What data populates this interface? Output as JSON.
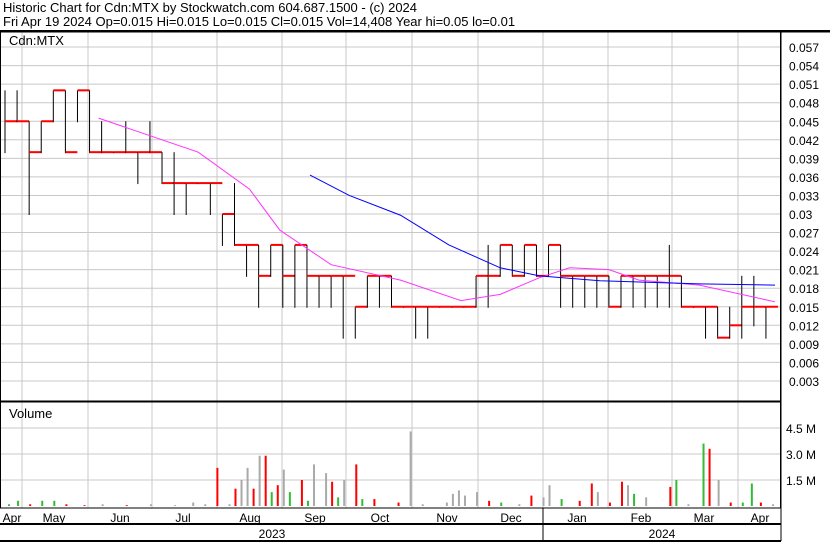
{
  "header": {
    "title": "Historic Chart for Cdn:MTX by Stockwatch.com 604.687.1500 - (c) 2024",
    "quote": "Fri Apr 19 2024  Op=0.015  Hi=0.015  Lo=0.015  Cl=0.015  Vol=14,408  Year hi=0.05  lo=0.01"
  },
  "colors": {
    "bar": "#000000",
    "close_tick": "#ff0000",
    "ma_short": "#ff33ff",
    "ma_long": "#0000ff",
    "vol_up": "#33bb33",
    "vol_down": "#ff0000",
    "vol_flat": "#aaaaaa",
    "grid": "#c8c8c8"
  },
  "chart_data": [
    {
      "type": "line",
      "title": "Cdn:MTX",
      "ylim": [
        0,
        0.06
      ],
      "y_ticks": [
        "0.057",
        "0.054",
        "0.051",
        "0.048",
        "0.045",
        "0.042",
        "0.039",
        "0.036",
        "0.033",
        "0.03",
        "0.027",
        "0.024",
        "0.021",
        "0.018",
        "0.015",
        "0.012",
        "0.009",
        "0.006",
        "0.003"
      ],
      "x_months": [
        "Apr",
        "May",
        "Jun",
        "Jul",
        "Aug",
        "Sep",
        "Oct",
        "Nov",
        "Dec",
        "Jan",
        "Feb",
        "Mar",
        "Apr"
      ],
      "x_years": [
        "2023",
        "2024"
      ],
      "ohlc_hlc": [
        [
          0,
          0.05,
          0.04,
          0.045
        ],
        [
          4,
          0.05,
          0.045,
          0.045
        ],
        [
          8,
          0.045,
          0.03,
          0.04
        ],
        [
          12,
          0.045,
          0.04,
          0.045
        ],
        [
          16,
          0.05,
          0.045,
          0.05
        ],
        [
          20,
          0.05,
          0.04,
          0.04
        ],
        [
          24,
          0.05,
          0.045,
          0.05
        ],
        [
          28,
          0.05,
          0.04,
          0.04
        ],
        [
          32,
          0.045,
          0.04,
          0.04
        ],
        [
          36,
          0.04,
          0.04,
          0.04
        ],
        [
          40,
          0.045,
          0.04,
          0.04
        ],
        [
          44,
          0.04,
          0.035,
          0.04
        ],
        [
          48,
          0.045,
          0.04,
          0.04
        ],
        [
          52,
          0.04,
          0.035,
          0.035
        ],
        [
          56,
          0.04,
          0.03,
          0.035
        ],
        [
          60,
          0.035,
          0.03,
          0.035
        ],
        [
          64,
          0.035,
          0.035,
          0.035
        ],
        [
          68,
          0.035,
          0.03,
          0.035
        ],
        [
          72,
          0.03,
          0.025,
          0.03
        ],
        [
          76,
          0.035,
          0.025,
          0.025
        ],
        [
          80,
          0.025,
          0.02,
          0.025
        ],
        [
          84,
          0.025,
          0.015,
          0.02
        ],
        [
          88,
          0.025,
          0.02,
          0.025
        ],
        [
          92,
          0.025,
          0.015,
          0.02
        ],
        [
          96,
          0.025,
          0.015,
          0.025
        ],
        [
          100,
          0.025,
          0.015,
          0.02
        ],
        [
          104,
          0.02,
          0.015,
          0.02
        ],
        [
          108,
          0.02,
          0.015,
          0.02
        ],
        [
          112,
          0.02,
          0.01,
          0.02
        ],
        [
          116,
          0.015,
          0.01,
          0.015
        ],
        [
          120,
          0.02,
          0.015,
          0.02
        ],
        [
          124,
          0.02,
          0.015,
          0.02
        ],
        [
          128,
          0.02,
          0.015,
          0.015
        ],
        [
          132,
          0.015,
          0.015,
          0.015
        ],
        [
          136,
          0.015,
          0.01,
          0.015
        ],
        [
          140,
          0.015,
          0.01,
          0.015
        ],
        [
          144,
          0.015,
          0.015,
          0.015
        ],
        [
          148,
          0.015,
          0.015,
          0.015
        ],
        [
          152,
          0.015,
          0.015,
          0.015
        ],
        [
          156,
          0.02,
          0.015,
          0.02
        ],
        [
          160,
          0.025,
          0.015,
          0.02
        ],
        [
          164,
          0.025,
          0.02,
          0.025
        ],
        [
          168,
          0.025,
          0.02,
          0.02
        ],
        [
          172,
          0.025,
          0.02,
          0.025
        ],
        [
          176,
          0.025,
          0.02,
          0.02
        ],
        [
          180,
          0.025,
          0.02,
          0.025
        ],
        [
          184,
          0.025,
          0.015,
          0.02
        ],
        [
          188,
          0.02,
          0.015,
          0.02
        ],
        [
          192,
          0.02,
          0.015,
          0.02
        ],
        [
          196,
          0.02,
          0.015,
          0.02
        ],
        [
          200,
          0.02,
          0.015,
          0.015
        ],
        [
          204,
          0.02,
          0.015,
          0.02
        ],
        [
          208,
          0.02,
          0.015,
          0.02
        ],
        [
          212,
          0.02,
          0.015,
          0.02
        ],
        [
          216,
          0.02,
          0.015,
          0.02
        ],
        [
          220,
          0.025,
          0.015,
          0.02
        ],
        [
          224,
          0.02,
          0.015,
          0.015
        ],
        [
          228,
          0.015,
          0.015,
          0.015
        ],
        [
          232,
          0.015,
          0.01,
          0.015
        ],
        [
          236,
          0.015,
          0.01,
          0.01
        ],
        [
          240,
          0.015,
          0.01,
          0.012
        ],
        [
          244,
          0.02,
          0.01,
          0.015
        ],
        [
          248,
          0.02,
          0.012,
          0.015
        ],
        [
          252,
          0.015,
          0.01,
          0.015
        ]
      ],
      "ma_short": [
        [
          31,
          0.0455
        ],
        [
          64,
          0.04
        ],
        [
          81,
          0.034
        ],
        [
          91,
          0.0274
        ],
        [
          108,
          0.0218
        ],
        [
          131,
          0.0193
        ],
        [
          151,
          0.016
        ],
        [
          164,
          0.017
        ],
        [
          177,
          0.0197
        ],
        [
          187,
          0.0213
        ],
        [
          200,
          0.021
        ],
        [
          210,
          0.0193
        ],
        [
          230,
          0.0185
        ],
        [
          255,
          0.0158
        ]
      ],
      "ma_long": [
        [
          101,
          0.0363
        ],
        [
          114,
          0.033
        ],
        [
          131,
          0.0298
        ],
        [
          147,
          0.025
        ],
        [
          164,
          0.0213
        ],
        [
          177,
          0.02
        ],
        [
          197,
          0.0192
        ],
        [
          230,
          0.0187
        ],
        [
          255,
          0.0185
        ]
      ]
    },
    {
      "type": "bar",
      "title": "Volume",
      "ylim": [
        0,
        6
      ],
      "y_ticks": [
        "4.5 M",
        "3.0 M",
        "1.5 M"
      ],
      "y_tick_values": [
        4.5,
        3.0,
        1.5
      ],
      "bars": [
        [
          1,
          0.1,
          "g"
        ],
        [
          4,
          0.3,
          "g"
        ],
        [
          8,
          0.1,
          "r"
        ],
        [
          12,
          0.3,
          "g"
        ],
        [
          16,
          0.3,
          "g"
        ],
        [
          20,
          0.1,
          "r"
        ],
        [
          26,
          0.05,
          "r"
        ],
        [
          32,
          0.1,
          "k"
        ],
        [
          40,
          0.05,
          "r"
        ],
        [
          48,
          0.1,
          "k"
        ],
        [
          56,
          0.05,
          "k"
        ],
        [
          62,
          0.2,
          "k"
        ],
        [
          66,
          0.1,
          "k"
        ],
        [
          70,
          2.2,
          "r"
        ],
        [
          74,
          0.1,
          "k"
        ],
        [
          76,
          1.0,
          "r"
        ],
        [
          78,
          1.5,
          "k"
        ],
        [
          80,
          2.2,
          "k"
        ],
        [
          82,
          1.0,
          "r"
        ],
        [
          84,
          2.9,
          "k"
        ],
        [
          86,
          2.9,
          "r"
        ],
        [
          88,
          0.8,
          "g"
        ],
        [
          90,
          1.2,
          "r"
        ],
        [
          92,
          2.1,
          "k"
        ],
        [
          94,
          0.8,
          "g"
        ],
        [
          98,
          1.5,
          "r"
        ],
        [
          100,
          0.3,
          "g"
        ],
        [
          102,
          2.4,
          "k"
        ],
        [
          106,
          1.9,
          "k"
        ],
        [
          108,
          1.4,
          "r"
        ],
        [
          110,
          0.5,
          "g"
        ],
        [
          112,
          1.5,
          "k"
        ],
        [
          116,
          2.4,
          "r"
        ],
        [
          118,
          0.4,
          "g"
        ],
        [
          122,
          0.4,
          "r"
        ],
        [
          130,
          0.2,
          "r"
        ],
        [
          134,
          4.3,
          "k"
        ],
        [
          138,
          0.1,
          "k"
        ],
        [
          146,
          0.2,
          "k"
        ],
        [
          148,
          0.7,
          "k"
        ],
        [
          150,
          0.9,
          "k"
        ],
        [
          152,
          0.6,
          "k"
        ],
        [
          156,
          0.8,
          "k"
        ],
        [
          160,
          0.3,
          "r"
        ],
        [
          164,
          0.2,
          "g"
        ],
        [
          170,
          0.1,
          "k"
        ],
        [
          174,
          0.6,
          "r"
        ],
        [
          178,
          0.5,
          "k"
        ],
        [
          180,
          1.2,
          "k"
        ],
        [
          184,
          0.4,
          "g"
        ],
        [
          190,
          0.3,
          "r"
        ],
        [
          194,
          1.3,
          "r"
        ],
        [
          196,
          0.8,
          "k"
        ],
        [
          200,
          0.2,
          "r"
        ],
        [
          204,
          1.4,
          "r"
        ],
        [
          206,
          1.2,
          "k"
        ],
        [
          208,
          0.7,
          "g"
        ],
        [
          212,
          0.5,
          "k"
        ],
        [
          220,
          1.1,
          "r"
        ],
        [
          222,
          1.5,
          "g"
        ],
        [
          226,
          0.1,
          "k"
        ],
        [
          231,
          3.6,
          "g"
        ],
        [
          233,
          3.3,
          "r"
        ],
        [
          236,
          1.5,
          "k"
        ],
        [
          240,
          0.2,
          "r"
        ],
        [
          244,
          0.2,
          "g"
        ],
        [
          247,
          1.3,
          "g"
        ],
        [
          250,
          0.2,
          "r"
        ],
        [
          254,
          0.1,
          "k"
        ]
      ]
    }
  ]
}
